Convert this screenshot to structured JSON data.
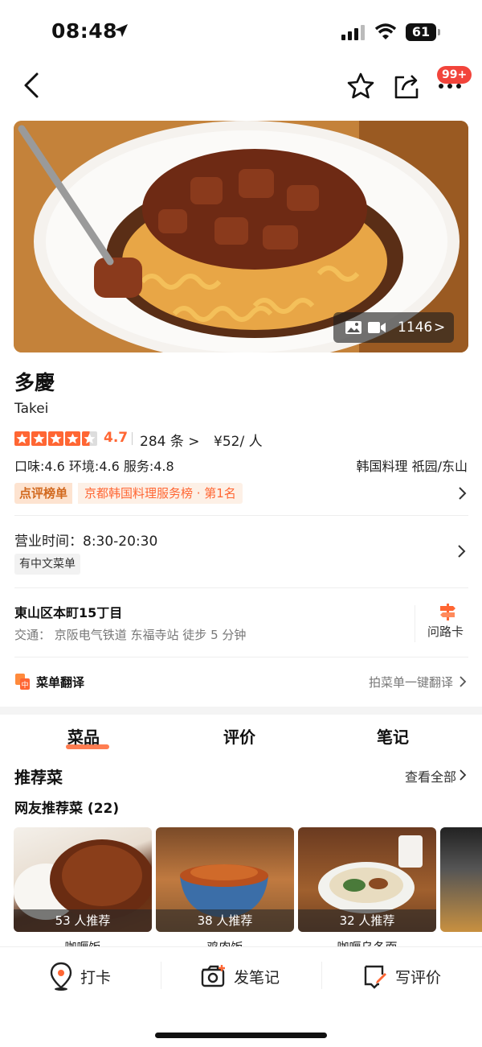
{
  "status_bar": {
    "time": "08:48",
    "battery": "61"
  },
  "nav": {
    "badge": "99+"
  },
  "hero": {
    "media_count": "1146",
    "chevron": ">"
  },
  "shop": {
    "name": "多慶",
    "name_romaji": "Takei",
    "rating_value": 4.5,
    "score": "4.7",
    "reviews": "284 条 >",
    "price": "¥52/ 人",
    "sub_scores": "口味:4.6 环境:4.6 服务:4.8",
    "category": "韩国料理 祇园/东山",
    "rank_tag": "点评榜单",
    "rank_text": "京都韩国料理服务榜 · 第1名"
  },
  "hours": {
    "text": "营业时间：8:30-20:30",
    "tag": "有中文菜单"
  },
  "address": {
    "line": "東山区本町15丁目",
    "transit": "交通：  京阪电气铁道 东福寺站 徒步 5 分钟",
    "card_label": "问路卡"
  },
  "menu_translate": {
    "label": "菜单翻译",
    "action": "拍菜单一键翻译"
  },
  "tabs": [
    {
      "label": "菜品",
      "active": true
    },
    {
      "label": "评价",
      "active": false
    },
    {
      "label": "笔记",
      "active": false
    }
  ],
  "recommend": {
    "title": "推荐菜",
    "see_all": "查看全部",
    "subtitle": "网友推荐菜 (22)",
    "dishes": [
      {
        "caption": "53 人推荐",
        "name": "咖喱饭"
      },
      {
        "caption": "38 人推荐",
        "name": "鸡肉饭"
      },
      {
        "caption": "32 人推荐",
        "name": "咖喱乌冬面"
      }
    ]
  },
  "bottom_bar": {
    "checkin": "打卡",
    "post_note": "发笔记",
    "write_review": "写评价"
  },
  "colors": {
    "accent": "#ff6633",
    "badge": "#f2443b"
  }
}
